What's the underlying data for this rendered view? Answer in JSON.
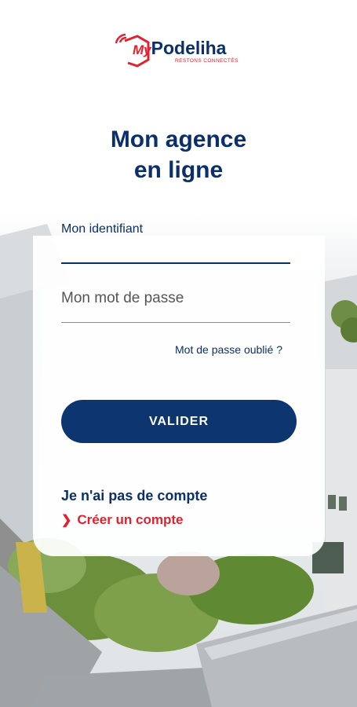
{
  "logo": {
    "prefix": "My",
    "name": "Podeliha",
    "tagline": "RESTONS CONNECTÉS"
  },
  "title": {
    "line1": "Mon agence",
    "line2": "en ligne"
  },
  "form": {
    "identifier_label": "Mon identifiant",
    "password_placeholder": "Mon mot de passe",
    "forgot_password": "Mot de passe oublié ?",
    "submit_label": "VALIDER"
  },
  "account": {
    "no_account": "Je n'ai pas de compte",
    "create_account": "Créer un compte"
  },
  "colors": {
    "primary": "#0b2f6b",
    "button": "#0d3570",
    "accent": "#e3202d"
  }
}
